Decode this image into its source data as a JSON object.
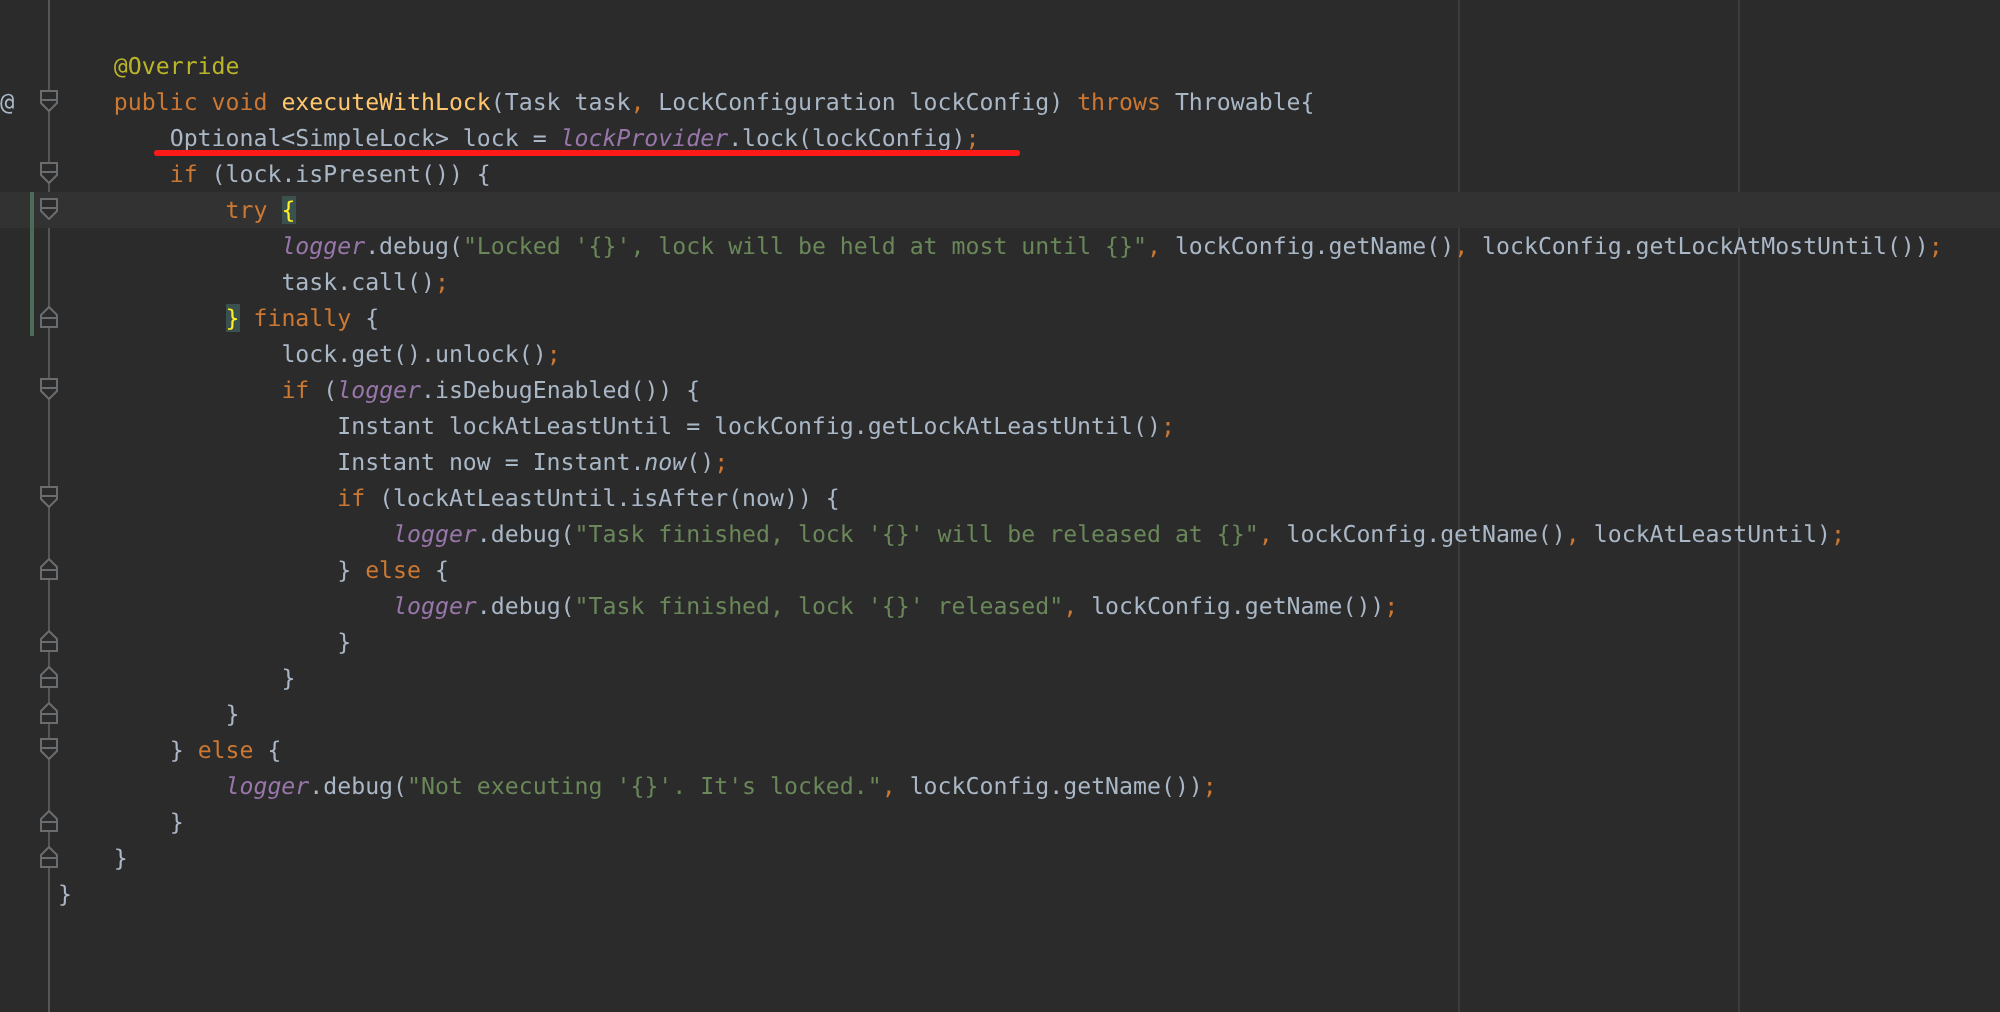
{
  "editor": {
    "lines": [
      {
        "fold_start": false,
        "fold_end": false,
        "tokens": [
          {
            "kind": "ann",
            "text": "    @Override"
          }
        ]
      },
      {
        "gutter": "@",
        "fold_start": true,
        "fold_end": false,
        "tokens": [
          {
            "kind": "kw",
            "text": "    public void "
          },
          {
            "kind": "decl",
            "text": "executeWithLock"
          },
          {
            "kind": "plain",
            "text": "(Task task"
          },
          {
            "kind": "punct",
            "text": ", "
          },
          {
            "kind": "plain",
            "text": "LockConfiguration lockConfig) "
          },
          {
            "kind": "kw",
            "text": "throws "
          },
          {
            "kind": "plain",
            "text": "Throwable{"
          }
        ]
      },
      {
        "underlined": true,
        "fold_start": false,
        "fold_end": false,
        "tokens": [
          {
            "kind": "plain",
            "text": "        Optional<SimpleLock> lock = "
          },
          {
            "kind": "field",
            "text": "lockProvider"
          },
          {
            "kind": "plain",
            "text": ".lock(lockConfig)"
          },
          {
            "kind": "punct",
            "text": ";"
          }
        ]
      },
      {
        "fold_start": true,
        "fold_end": false,
        "tokens": [
          {
            "kind": "kw",
            "text": "        if "
          },
          {
            "kind": "plain",
            "text": "(lock.isPresent()) {"
          }
        ]
      },
      {
        "fold_start": true,
        "fold_end": false,
        "current": true,
        "changed": true,
        "tokens": [
          {
            "kind": "kw",
            "text": "            try "
          },
          {
            "kind": "match",
            "text": "{"
          }
        ]
      },
      {
        "fold_start": false,
        "fold_end": false,
        "changed": true,
        "tokens": [
          {
            "kind": "field",
            "text": "                logger"
          },
          {
            "kind": "plain",
            "text": ".debug("
          },
          {
            "kind": "str",
            "text": "\"Locked '{}', lock will be held at most until {}\""
          },
          {
            "kind": "punct",
            "text": ", "
          },
          {
            "kind": "plain",
            "text": "lockConfig.getName()"
          },
          {
            "kind": "punct",
            "text": ", "
          },
          {
            "kind": "plain",
            "text": "lockConfig.getLockAtMostUntil())"
          },
          {
            "kind": "punct",
            "text": ";"
          }
        ]
      },
      {
        "fold_start": false,
        "fold_end": false,
        "changed": true,
        "tokens": [
          {
            "kind": "plain",
            "text": "                task.call()"
          },
          {
            "kind": "punct",
            "text": ";"
          }
        ]
      },
      {
        "fold_start": false,
        "fold_end": true,
        "changed": true,
        "tokens": [
          {
            "kind": "match",
            "text": "            }"
          },
          {
            "kind": "kw",
            "text": " finally "
          },
          {
            "kind": "plain",
            "text": "{"
          }
        ]
      },
      {
        "fold_start": false,
        "fold_end": false,
        "tokens": [
          {
            "kind": "plain",
            "text": "                lock.get().unlock()"
          },
          {
            "kind": "punct",
            "text": ";"
          }
        ]
      },
      {
        "fold_start": true,
        "fold_end": false,
        "tokens": [
          {
            "kind": "kw",
            "text": "                if "
          },
          {
            "kind": "plain",
            "text": "("
          },
          {
            "kind": "field",
            "text": "logger"
          },
          {
            "kind": "plain",
            "text": ".isDebugEnabled()) {"
          }
        ]
      },
      {
        "fold_start": false,
        "fold_end": false,
        "tokens": [
          {
            "kind": "plain",
            "text": "                    Instant lockAtLeastUntil = lockConfig.getLockAtLeastUntil()"
          },
          {
            "kind": "punct",
            "text": ";"
          }
        ]
      },
      {
        "fold_start": false,
        "fold_end": false,
        "tokens": [
          {
            "kind": "plain",
            "text": "                    Instant now = Instant."
          },
          {
            "kind": "italic",
            "text": "now"
          },
          {
            "kind": "plain",
            "text": "()"
          },
          {
            "kind": "punct",
            "text": ";"
          }
        ]
      },
      {
        "fold_start": true,
        "fold_end": false,
        "tokens": [
          {
            "kind": "kw",
            "text": "                    if "
          },
          {
            "kind": "plain",
            "text": "(lockAtLeastUntil.isAfter(now)) {"
          }
        ]
      },
      {
        "fold_start": false,
        "fold_end": false,
        "tokens": [
          {
            "kind": "field",
            "text": "                        logger"
          },
          {
            "kind": "plain",
            "text": ".debug("
          },
          {
            "kind": "str",
            "text": "\"Task finished, lock '{}' will be released at {}\""
          },
          {
            "kind": "punct",
            "text": ", "
          },
          {
            "kind": "plain",
            "text": "lockConfig.getName()"
          },
          {
            "kind": "punct",
            "text": ", "
          },
          {
            "kind": "plain",
            "text": "lockAtLeastUntil)"
          },
          {
            "kind": "punct",
            "text": ";"
          }
        ]
      },
      {
        "fold_start": false,
        "fold_end": true,
        "tokens": [
          {
            "kind": "plain",
            "text": "                    } "
          },
          {
            "kind": "kw",
            "text": "else "
          },
          {
            "kind": "plain",
            "text": "{"
          }
        ]
      },
      {
        "fold_start": false,
        "fold_end": false,
        "tokens": [
          {
            "kind": "field",
            "text": "                        logger"
          },
          {
            "kind": "plain",
            "text": ".debug("
          },
          {
            "kind": "str",
            "text": "\"Task finished, lock '{}' released\""
          },
          {
            "kind": "punct",
            "text": ", "
          },
          {
            "kind": "plain",
            "text": "lockConfig.getName())"
          },
          {
            "kind": "punct",
            "text": ";"
          }
        ]
      },
      {
        "fold_start": false,
        "fold_end": true,
        "tokens": [
          {
            "kind": "plain",
            "text": "                    }"
          }
        ]
      },
      {
        "fold_start": false,
        "fold_end": true,
        "tokens": [
          {
            "kind": "plain",
            "text": "                }"
          }
        ]
      },
      {
        "fold_start": false,
        "fold_end": true,
        "tokens": [
          {
            "kind": "plain",
            "text": "            }"
          }
        ]
      },
      {
        "fold_start": true,
        "fold_end": false,
        "tokens": [
          {
            "kind": "plain",
            "text": "        } "
          },
          {
            "kind": "kw",
            "text": "else "
          },
          {
            "kind": "plain",
            "text": "{"
          }
        ]
      },
      {
        "fold_start": false,
        "fold_end": false,
        "tokens": [
          {
            "kind": "field",
            "text": "            logger"
          },
          {
            "kind": "plain",
            "text": ".debug("
          },
          {
            "kind": "str",
            "text": "\"Not executing '{}'. It's locked.\""
          },
          {
            "kind": "punct",
            "text": ", "
          },
          {
            "kind": "plain",
            "text": "lockConfig.getName())"
          },
          {
            "kind": "punct",
            "text": ";"
          }
        ]
      },
      {
        "fold_start": false,
        "fold_end": true,
        "tokens": [
          {
            "kind": "plain",
            "text": "        }"
          }
        ]
      },
      {
        "fold_start": false,
        "fold_end": true,
        "tokens": [
          {
            "kind": "plain",
            "text": "    }"
          }
        ]
      },
      {
        "fold_start": false,
        "fold_end": false,
        "tokens": [
          {
            "kind": "plain",
            "text": "}"
          }
        ]
      }
    ]
  }
}
